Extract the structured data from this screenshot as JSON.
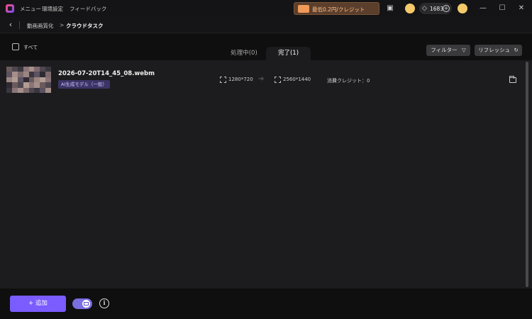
{
  "titlebar": {
    "menu": "メニュー",
    "settings": "環境設定",
    "feedback": "フィードバック",
    "promo": "最低0.2円/クレジット",
    "credits": "1683"
  },
  "breadcrumb": {
    "parent": "動画画質化",
    "separator": ">",
    "current": "クラウドタスク"
  },
  "toolbar": {
    "select_all": "すべて",
    "tab_processing": "処理中(0)",
    "tab_done": "完了(1)",
    "filter": "フィルター",
    "refresh": "リフレッシュ"
  },
  "tasks": [
    {
      "file_name": "2026-07-20T14_45_08.webm",
      "model": "AI生成モデル（一般）",
      "input_res": "1280*720",
      "output_res": "2560*1440",
      "credit_used": "消費クレジット：0"
    }
  ],
  "bottom": {
    "add": "+ 追加"
  },
  "colors": {
    "accent": "#7a5cff",
    "panel": "#1c1c1e",
    "background": "#0f0f10"
  }
}
